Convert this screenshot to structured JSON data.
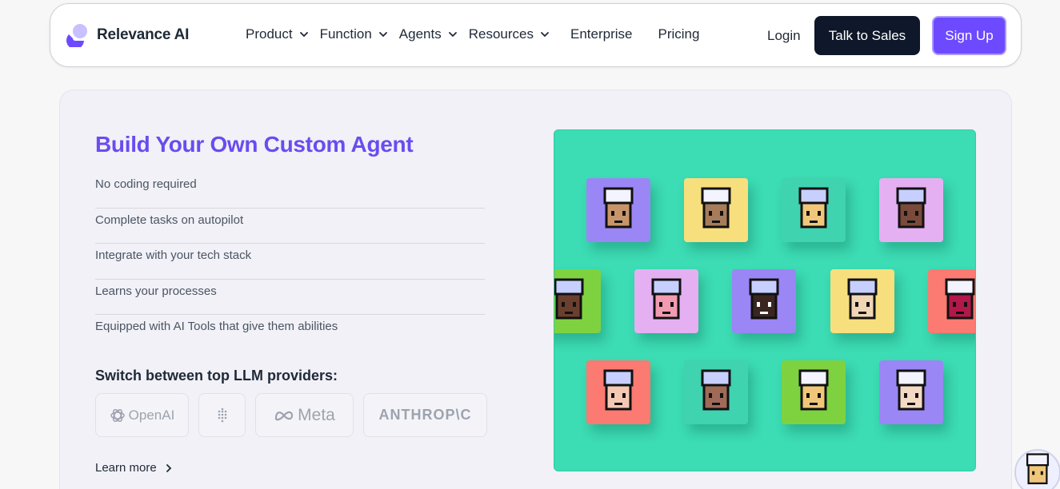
{
  "nav": {
    "brand": "Relevance AI",
    "menu": [
      {
        "label": "Product",
        "dropdown": true
      },
      {
        "label": "Function",
        "dropdown": true
      },
      {
        "label": "Agents",
        "dropdown": true
      },
      {
        "label": "Resources",
        "dropdown": true
      },
      {
        "label": "Enterprise",
        "dropdown": false
      },
      {
        "label": "Pricing",
        "dropdown": false
      }
    ],
    "login": "Login",
    "talk_to_sales": "Talk to Sales",
    "sign_up": "Sign Up"
  },
  "hero": {
    "title": "Build Your Own Custom Agent",
    "features": [
      "No coding required",
      "Complete tasks on autopilot",
      "Integrate with your tech stack",
      "Learns your processes",
      "Equipped with AI Tools that give them abilities"
    ],
    "switch_title": "Switch between top LLM providers:",
    "providers": [
      "OpenAI",
      "",
      "Meta",
      "ANTHROP\\C"
    ],
    "learn_more": "Learn more"
  },
  "colors": {
    "accent": "#6d4aff",
    "title": "#6a4cf0",
    "dark_button": "#0f172a",
    "panel_bg": "#3cdcb4"
  },
  "icons": {
    "logo": "relevance-logo-icon",
    "chevron": "chevron-down-icon",
    "openai": "openai-logo-icon",
    "grid": "dot-grid-logo-icon",
    "meta": "meta-infinity-icon",
    "arrow": "chevron-right-icon"
  }
}
